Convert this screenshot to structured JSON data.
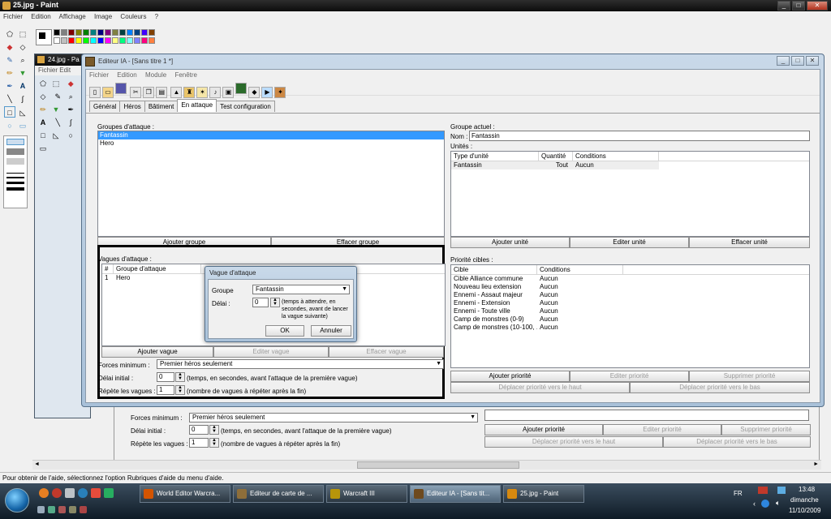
{
  "paint_back": {
    "title": "25.jpg - Paint",
    "menu": [
      "Fichier",
      "Edition",
      "Affichage",
      "Image",
      "Couleurs",
      "?"
    ],
    "status": "Pour obtenir de l'aide, sélectionnez l'option Rubriques d'aide du menu d'aide."
  },
  "paint_mid": {
    "title": "24.jpg - Pa",
    "menu": [
      "Fichier",
      "Edit"
    ]
  },
  "editor": {
    "title": "Editeur IA - [Sans titre 1 *]",
    "menu": [
      "Fichier",
      "Edition",
      "Module",
      "Fenêtre"
    ],
    "tabs": [
      "Général",
      "Héros",
      "Bâtiment",
      "En attaque",
      "Test configuration"
    ],
    "attack_groups_label": "Groupes d'attaque :",
    "attack_groups": [
      "Fantassin",
      "Hero"
    ],
    "btn_add_group": "Ajouter groupe",
    "btn_delete_group": "Effacer groupe",
    "waves_label": "Vagues d'attaque :",
    "waves_headers": [
      "#",
      "Groupe d'attaque"
    ],
    "waves_rows": [
      {
        "n": "1",
        "group": "Hero"
      }
    ],
    "btn_add_wave": "Ajouter vague",
    "btn_edit_wave": "Editer vague",
    "btn_delete_wave": "Effacer vague",
    "min_forces_label": "Forces minimum :",
    "min_forces_value": "Premier héros seulement",
    "initial_delay_label": "Délai initial :",
    "initial_delay_value": "0",
    "initial_delay_hint": "(temps, en secondes, avant l'attaque de la première vague)",
    "repeat_label": "Répète les vagues :",
    "repeat_value": "1",
    "repeat_hint": "(nombre de vagues à répéter après la fin)",
    "current_group_label": "Groupe actuel :",
    "name_label": "Nom :",
    "name_value": "Fantassin",
    "units_label": "Unités :",
    "units_headers": [
      "Type d'unité",
      "Quantité",
      "Conditions"
    ],
    "units_rows": [
      {
        "type": "Fantassin",
        "qty": "Tout",
        "cond": "Aucun"
      }
    ],
    "btn_add_unit": "Ajouter unité",
    "btn_edit_unit": "Editer unité",
    "btn_delete_unit": "Effacer unité",
    "target_priority_label": "Priorité cibles :",
    "target_headers": [
      "Cible",
      "Conditions"
    ],
    "targets": [
      {
        "target": "Cible Alliance commune",
        "cond": "Aucun"
      },
      {
        "target": "Nouveau lieu extension",
        "cond": "Aucun"
      },
      {
        "target": "Ennemi - Assaut majeur",
        "cond": "Aucun"
      },
      {
        "target": "Ennemi - Extension",
        "cond": "Aucun"
      },
      {
        "target": "Ennemi - Toute ville",
        "cond": "Aucun"
      },
      {
        "target": "Camp de monstres (0-9)",
        "cond": "Aucun"
      },
      {
        "target": "Camp de monstres (10-100, ...",
        "cond": "Aucun"
      }
    ],
    "btn_add_priority": "Ajouter priorité",
    "btn_edit_priority": "Editer priorité",
    "btn_delete_priority": "Supprimer priorité",
    "btn_move_up": "Déplacer priorité vers le haut",
    "btn_move_down": "Déplacer priorité vers le bas"
  },
  "dialog": {
    "title": "Vague d'attaque",
    "group_label": "Groupe",
    "group_value": "Fantassin",
    "delay_label": "Délai :",
    "delay_value": "0",
    "delay_hint": "(temps à attendre, en secondes, avant de lancer la vague suivante)",
    "ok": "OK",
    "cancel": "Annuler"
  },
  "behind": {
    "min_forces_label": "Forces minimum :",
    "min_forces_value": "Premier héros seulement",
    "initial_delay_label": "Délai initial :",
    "initial_delay_value": "0",
    "initial_delay_hint": "(temps, en secondes, avant l'attaque de la première vague)",
    "repeat_label": "Répète les vagues :",
    "repeat_value": "1",
    "repeat_hint": "(nombre de vagues à répéter après la fin)",
    "btn_add_priority": "Ajouter priorité",
    "btn_edit_priority": "Editer priorité",
    "btn_delete_priority": "Supprimer priorité",
    "btn_move_up": "Déplacer priorité vers le haut",
    "btn_move_down": "Déplacer priorité vers le bas"
  },
  "taskbar": {
    "items": [
      "World Editor Warcra...",
      "Editeur de carte de ...",
      "Warcraft III",
      "Editeur IA - [Sans tit...",
      "25.jpg - Paint"
    ],
    "active_index": 3,
    "lang": "FR",
    "time": "13:48",
    "day": "dimanche",
    "date": "11/10/2009"
  },
  "colors": {
    "highlight": "#3399ff",
    "palette": [
      "#000000",
      "#808080",
      "#800000",
      "#808000",
      "#008000",
      "#008080",
      "#000080",
      "#800080",
      "#808040",
      "#004040",
      "#0080ff",
      "#004080",
      "#4000ff",
      "#804000",
      "#ffffff",
      "#c0c0c0",
      "#ff0000",
      "#ffff00",
      "#00ff00",
      "#00ffff",
      "#0000ff",
      "#ff00ff",
      "#ffff80",
      "#00ff80",
      "#80ffff",
      "#8080ff",
      "#ff0080",
      "#ff8040"
    ]
  }
}
